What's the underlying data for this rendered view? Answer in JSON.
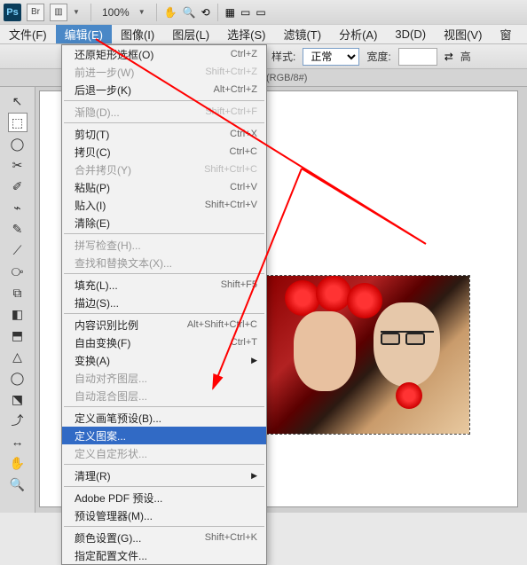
{
  "topbar": {
    "logo_text": "Ps",
    "br_text": "Br",
    "zoom": "100%",
    "hand_icon": "✋",
    "zoom_icon": "🔍",
    "grid_icon": "▦",
    "doc_icon": "▭"
  },
  "menubar": [
    {
      "label": "文件(F)"
    },
    {
      "label": "编辑(E)",
      "active": true
    },
    {
      "label": "图像(I)"
    },
    {
      "label": "图层(L)"
    },
    {
      "label": "选择(S)"
    },
    {
      "label": "滤镜(T)"
    },
    {
      "label": "分析(A)"
    },
    {
      "label": "3D(D)"
    },
    {
      "label": "视图(V)"
    },
    {
      "label": "窗"
    }
  ],
  "optbar": {
    "style_label": "样式:",
    "style_value": "正常",
    "width_label": "宽度:",
    "high_label": "高"
  },
  "doctab": "(RGB/8#)",
  "tools": [
    "↖",
    "⬚",
    "◯",
    "✂",
    "✐",
    "⌁",
    "✎",
    "⟋",
    "⧂",
    "⧉",
    "◧",
    "⬒",
    "△",
    "◯",
    "⬔",
    "⤴",
    "↔",
    "✋",
    "🔍"
  ],
  "menu": {
    "groups": [
      [
        {
          "label": "还原矩形选框(O)",
          "shortcut": "Ctrl+Z"
        },
        {
          "label": "前进一步(W)",
          "shortcut": "Shift+Ctrl+Z",
          "disabled": true
        },
        {
          "label": "后退一步(K)",
          "shortcut": "Alt+Ctrl+Z"
        }
      ],
      [
        {
          "label": "渐隐(D)...",
          "shortcut": "Shift+Ctrl+F",
          "disabled": true
        }
      ],
      [
        {
          "label": "剪切(T)",
          "shortcut": "Ctrl+X"
        },
        {
          "label": "拷贝(C)",
          "shortcut": "Ctrl+C"
        },
        {
          "label": "合并拷贝(Y)",
          "shortcut": "Shift+Ctrl+C",
          "disabled": true
        },
        {
          "label": "粘贴(P)",
          "shortcut": "Ctrl+V"
        },
        {
          "label": "贴入(I)",
          "shortcut": "Shift+Ctrl+V"
        },
        {
          "label": "清除(E)"
        }
      ],
      [
        {
          "label": "拼写检查(H)...",
          "disabled": true
        },
        {
          "label": "查找和替换文本(X)...",
          "disabled": true
        }
      ],
      [
        {
          "label": "填充(L)...",
          "shortcut": "Shift+F5"
        },
        {
          "label": "描边(S)..."
        }
      ],
      [
        {
          "label": "内容识别比例",
          "shortcut": "Alt+Shift+Ctrl+C"
        },
        {
          "label": "自由变换(F)",
          "shortcut": "Ctrl+T"
        },
        {
          "label": "变换(A)",
          "submenu": true
        },
        {
          "label": "自动对齐图层...",
          "disabled": true
        },
        {
          "label": "自动混合图层...",
          "disabled": true
        }
      ],
      [
        {
          "label": "定义画笔预设(B)..."
        },
        {
          "label": "定义图案...",
          "highlighted": true
        },
        {
          "label": "定义自定形状...",
          "disabled": true
        }
      ],
      [
        {
          "label": "清理(R)",
          "submenu": true
        }
      ],
      [
        {
          "label": "Adobe PDF 预设..."
        },
        {
          "label": "预设管理器(M)..."
        }
      ],
      [
        {
          "label": "颜色设置(G)...",
          "shortcut": "Shift+Ctrl+K"
        },
        {
          "label": "指定配置文件..."
        }
      ]
    ]
  }
}
